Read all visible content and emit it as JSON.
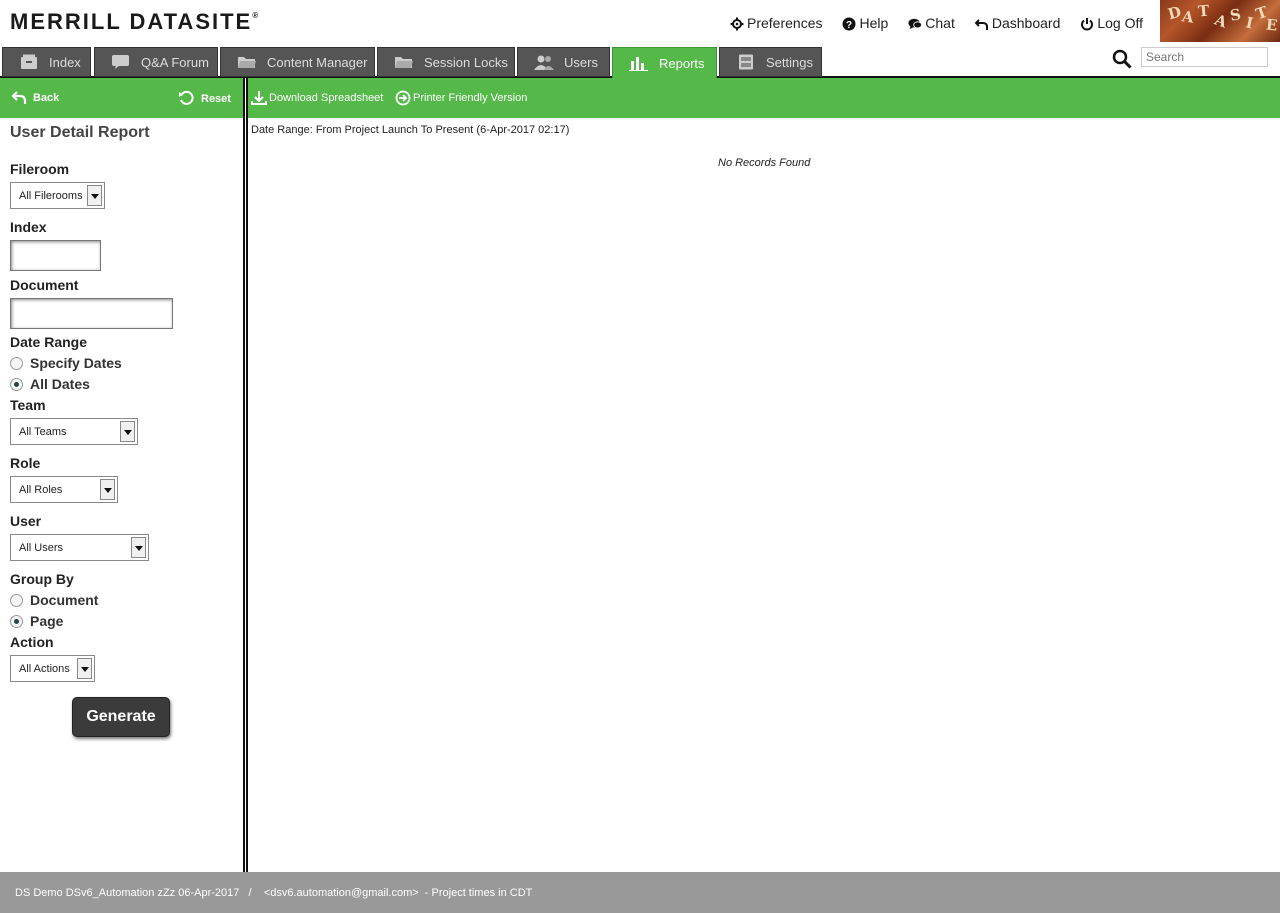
{
  "header": {
    "logo_text": "MERRILL DATASITE",
    "logo_mark": "®",
    "links": [
      {
        "label": "Preferences",
        "icon": "gear-icon"
      },
      {
        "label": "Help",
        "icon": "help-icon"
      },
      {
        "label": "Chat",
        "icon": "chat-icon"
      },
      {
        "label": "Dashboard",
        "icon": "back-arrow-icon"
      },
      {
        "label": "Log Off",
        "icon": "power-icon"
      }
    ]
  },
  "tabs": [
    {
      "label": "Index",
      "icon": "index-icon"
    },
    {
      "label": "Q&A Forum",
      "icon": "speech-bubble-icon"
    },
    {
      "label": "Content Manager",
      "icon": "folder-icon"
    },
    {
      "label": "Session Locks",
      "icon": "folder-open-icon"
    },
    {
      "label": "Users",
      "icon": "users-icon"
    },
    {
      "label": "Reports",
      "icon": "bar-chart-icon",
      "active": true
    },
    {
      "label": "Settings",
      "icon": "cabinet-icon"
    }
  ],
  "search": {
    "placeholder": "Search"
  },
  "left_toolbar": {
    "back_label": "Back",
    "reset_label": "Reset"
  },
  "form": {
    "title": "User Detail Report",
    "fileroom_label": "Fileroom",
    "fileroom_value": "All Filerooms",
    "index_label": "Index",
    "index_value": "",
    "document_label": "Document",
    "document_value": "",
    "date_range_label": "Date Range",
    "date_options": [
      {
        "label": "Specify Dates",
        "selected": false
      },
      {
        "label": "All Dates",
        "selected": true
      }
    ],
    "team_label": "Team",
    "team_value": "All Teams",
    "role_label": "Role",
    "role_value": "All Roles",
    "user_label": "User",
    "user_value": "All Users",
    "group_by_label": "Group By",
    "group_options": [
      {
        "label": "Document",
        "selected": false
      },
      {
        "label": "Page",
        "selected": true
      }
    ],
    "action_label": "Action",
    "action_value": "All Actions",
    "generate_label": "Generate"
  },
  "right_toolbar": {
    "download_label": "Download Spreadsheet",
    "printer_label": "Printer Friendly Version"
  },
  "report": {
    "date_range_text": "Date Range: From Project Launch To Present (6-Apr-2017 02:17)",
    "empty_text": "No Records Found"
  },
  "footer": {
    "text": "DS Demo DSv6_Automation zZz 06-Apr-2017   /    <dsv6.automation@gmail.com>  - Project times in CDT"
  },
  "colors": {
    "accent": "#55b94a",
    "tab_bg": "#555555",
    "footer_bg": "#999999",
    "button_dark": "#3b3b3b"
  }
}
